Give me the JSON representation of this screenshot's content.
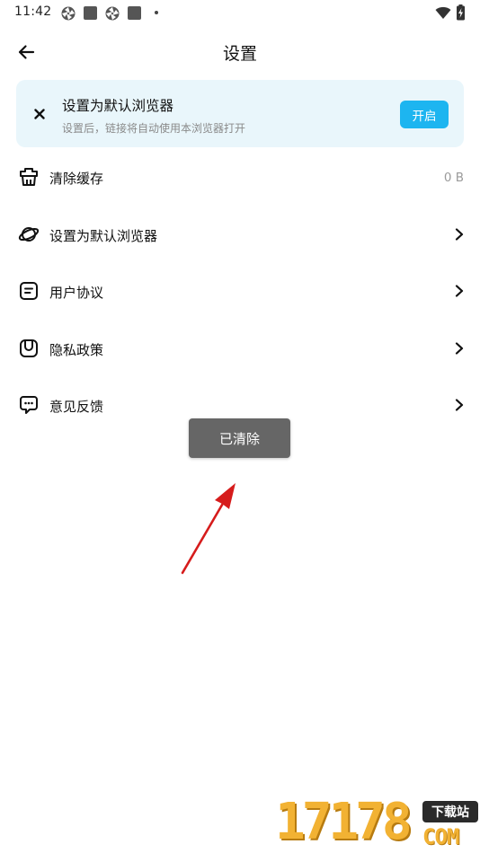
{
  "status_bar": {
    "time": "11:42"
  },
  "header": {
    "title": "设置",
    "back_icon": "arrow-left-icon"
  },
  "banner": {
    "title": "设置为默认浏览器",
    "subtitle": "设置后，链接将自动使用本浏览器打开",
    "button_label": "开启",
    "button_color": "#1db5f0",
    "background": "#e9f6fb"
  },
  "menu": {
    "items": [
      {
        "label": "清除缓存",
        "value": "0 B",
        "icon": "basket-icon"
      },
      {
        "label": "设置为默认浏览器",
        "icon": "planet-icon"
      },
      {
        "label": "用户协议",
        "icon": "document-icon"
      },
      {
        "label": "隐私政策",
        "icon": "shield-icon"
      },
      {
        "label": "意见反馈",
        "icon": "chat-icon"
      }
    ]
  },
  "toast": {
    "text": "已清除"
  },
  "watermark": {
    "digits": "17178",
    "badge": "下载站",
    "suffix": "COM"
  }
}
